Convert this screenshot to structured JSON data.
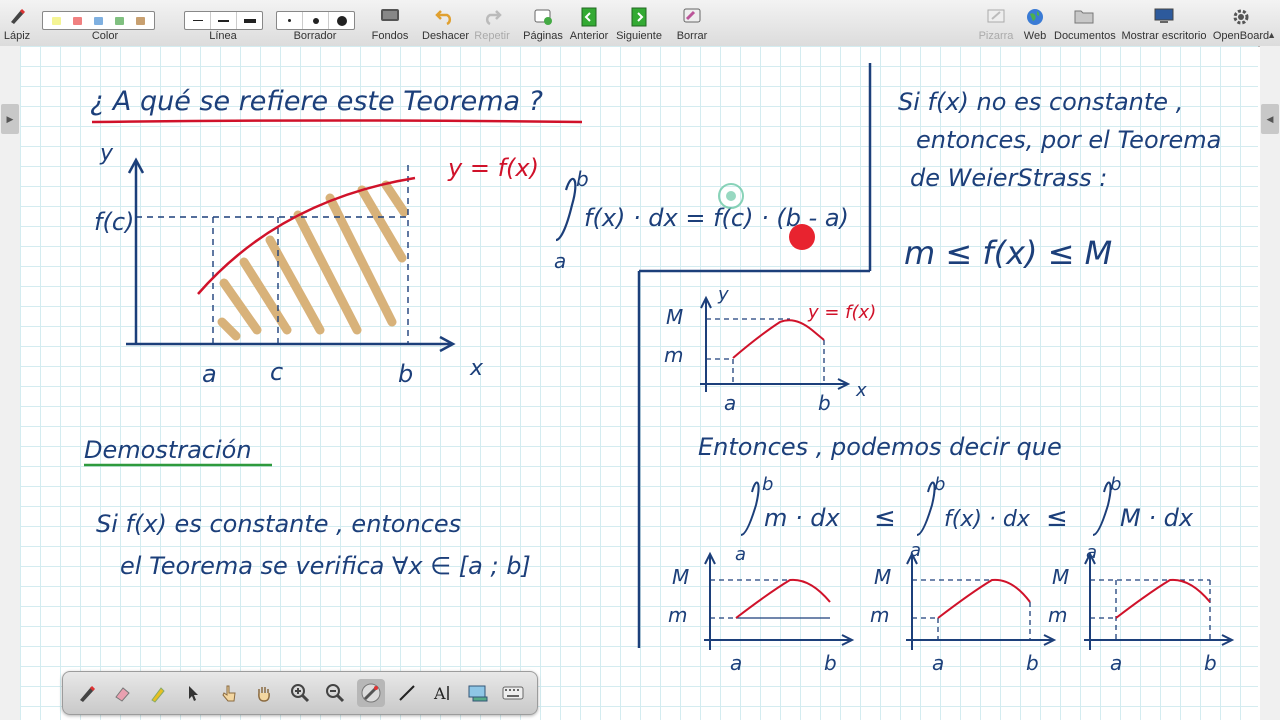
{
  "toolbar": {
    "items": [
      {
        "label": "Lápiz",
        "icon": "pencil-icon"
      },
      {
        "label": "Color",
        "icon": "color-palette-icon"
      },
      {
        "label": "Línea",
        "icon": "line-width-icon"
      },
      {
        "label": "Borrador",
        "icon": "eraser-size-icon"
      },
      {
        "label": "Fondos",
        "icon": "backgrounds-icon"
      },
      {
        "label": "Deshacer",
        "icon": "undo-icon"
      },
      {
        "label": "Repetir",
        "icon": "redo-icon"
      },
      {
        "label": "Páginas",
        "icon": "pages-icon"
      },
      {
        "label": "Anterior",
        "icon": "previous-icon"
      },
      {
        "label": "Siguiente",
        "icon": "next-icon"
      },
      {
        "label": "Borrar",
        "icon": "erase-page-icon"
      },
      {
        "label": "Pizarra",
        "icon": "board-icon"
      },
      {
        "label": "Web",
        "icon": "globe-icon"
      },
      {
        "label": "Documentos",
        "icon": "folder-icon"
      },
      {
        "label": "Mostrar escritorio",
        "icon": "desktop-icon"
      },
      {
        "label": "OpenBoard",
        "icon": "gear-icon"
      }
    ],
    "palette_colors": [
      "#f4f494",
      "#f08080",
      "#7fb0e0",
      "#80c080",
      "#c8a070"
    ]
  },
  "board": {
    "left": {
      "question": "¿ A qué se refiere este Teorema ?",
      "graph_y": "y",
      "graph_x": "x",
      "graph_fc": "f(c)",
      "graph_a": "a",
      "graph_c": "c",
      "graph_b": "b",
      "graph_curve": "y = f(x)",
      "demo_title": "Demostración",
      "demo_line1": "Si  f(x)  es constante , entonces",
      "demo_line2": "el Teorema se verifica  ∀x ∈ [a ; b]"
    },
    "middle": {
      "int_upper": "b",
      "int_lower": "a",
      "formula": "f(x) · dx  =  f(c) · (b - a)"
    },
    "right": {
      "line1": "Si f(x) no es constante ,",
      "line2": "entonces, por el Teorema",
      "line3": "de WeierStrass :",
      "inequality": "m  ≤  f(x)  ≤  M",
      "mini_M": "M",
      "mini_m": "m",
      "mini_y": "y",
      "mini_x": "x",
      "mini_a": "a",
      "mini_b": "b",
      "mini_curve": "y = f(x)",
      "conclusion": "Entonces , podemos decir que",
      "int1": "m · dx",
      "int2": "f(x) · dx",
      "int3": "M · dx",
      "leq": "≤",
      "int_upper": "b",
      "int_lower": "a"
    }
  },
  "colors": {
    "ink_blue": "#1c3f7a",
    "ink_red": "#d0122a",
    "ink_green": "#2e9a3c",
    "hatch": "#d8b27a",
    "grid": "#d4ecf0"
  }
}
